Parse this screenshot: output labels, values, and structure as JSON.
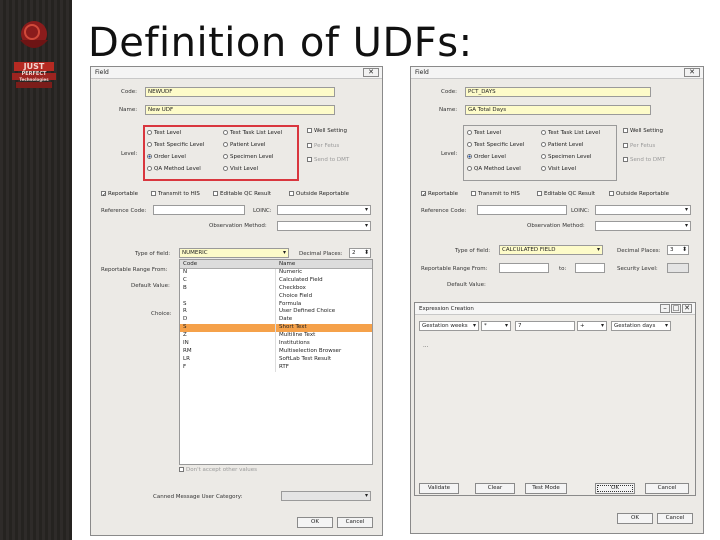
{
  "slide": {
    "title": "Definition of UDFs:",
    "logo_text": [
      "JUST",
      "PERFECT",
      "Technologies"
    ]
  },
  "left_dialog": {
    "title": "Field",
    "close": "✕",
    "code_label": "Code:",
    "code_value": "NEWUDF",
    "name_label": "Name:",
    "name_value": "New UDF",
    "level_label": "Level:",
    "levels": [
      {
        "label": "Test Level",
        "checked": false
      },
      {
        "label": "Test Task List Level",
        "checked": false
      },
      {
        "label": "Test Specific Level",
        "checked": false
      },
      {
        "label": "Patient Level",
        "checked": false
      },
      {
        "label": "Order Level",
        "checked": true
      },
      {
        "label": "Specimen Level",
        "checked": false
      },
      {
        "label": "QA Method Level",
        "checked": false
      },
      {
        "label": "Visit Level",
        "checked": false
      }
    ],
    "extra_checks": [
      "Well Setting",
      "Per Fetus",
      "Send to DMT"
    ],
    "flags": [
      "Reportable",
      "Transmit to HIS",
      "Editable QC Result",
      "Outside Reportable"
    ],
    "ref_code_label": "Reference Code:",
    "loinc_label": "LOINC:",
    "obs_method_label": "Observation Method:",
    "type_label": "Type of field:",
    "type_value": "NUMERIC",
    "decimal_label": "Decimal Places:",
    "decimal_value": "2",
    "range_label": "Reportable Range From:",
    "default_label": "Default Value:",
    "choice_label": "Choice:",
    "list_headers": [
      "Code",
      "Name"
    ],
    "list_rows": [
      [
        "N",
        "Numeric"
      ],
      [
        "C",
        "Calculated Field"
      ],
      [
        "B",
        "Checkbox"
      ],
      [
        "",
        "Choice Field"
      ],
      [
        "S",
        "Formula"
      ],
      [
        "R",
        "User Defined Choice"
      ],
      [
        "D",
        "Date"
      ],
      [
        "S",
        "Short Text"
      ],
      [
        "Z",
        "Multiline Text"
      ],
      [
        "IN",
        "Institutions"
      ],
      [
        "RM",
        "Multiselection Browser"
      ],
      [
        "LR",
        "SoftLab Test Result"
      ],
      [
        "F",
        "RTF"
      ]
    ],
    "selected_row": 7,
    "dont_accept": "Don't accept other values",
    "canned_label": "Canned Message User Category:",
    "ok": "OK",
    "cancel": "Cancel"
  },
  "right_dialog": {
    "title": "Field",
    "close": "✕",
    "code_label": "Code:",
    "code_value": "PCT_DAYS",
    "name_label": "Name:",
    "name_value": "GA Total Days",
    "level_label": "Level:",
    "levels": [
      {
        "label": "Test Level",
        "checked": false
      },
      {
        "label": "Test Task List Level",
        "checked": false
      },
      {
        "label": "Test Specific Level",
        "checked": false
      },
      {
        "label": "Patient Level",
        "checked": false
      },
      {
        "label": "Order Level",
        "checked": true
      },
      {
        "label": "Specimen Level",
        "checked": false
      },
      {
        "label": "QA Method Level",
        "checked": false
      },
      {
        "label": "Visit Level",
        "checked": false
      }
    ],
    "extra_checks": [
      "Well Setting",
      "Per Fetus",
      "Send to DMT"
    ],
    "flags": [
      "Reportable",
      "Transmit to HIS",
      "Editable QC Result",
      "Outside Reportable"
    ],
    "ref_code_label": "Reference Code:",
    "loinc_label": "LOINC:",
    "obs_method_label": "Observation Method:",
    "type_label": "Type of field:",
    "type_value": "CALCULATED FIELD",
    "decimal_label": "Decimal Places:",
    "decimal_value": "3",
    "range_label": "Reportable Range From:",
    "range_to": "to:",
    "security_label": "Security Level:",
    "default_label": "Default Value:",
    "ok": "OK",
    "cancel": "Cancel"
  },
  "expression_dialog": {
    "title": "Expression Creation",
    "controls": [
      "Gestation weeks",
      "*",
      "7",
      "+",
      "Gestation days"
    ],
    "body_text": "...",
    "buttons": [
      "Validate",
      "Clear",
      "Test Mode",
      "OK",
      "Cancel"
    ]
  }
}
